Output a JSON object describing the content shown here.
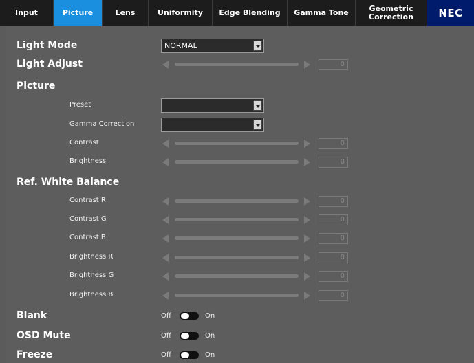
{
  "tabs": [
    {
      "label": "Input",
      "active": false
    },
    {
      "label": "Picture",
      "active": true
    },
    {
      "label": "Lens",
      "active": false
    },
    {
      "label": "Uniformity",
      "active": false
    },
    {
      "label": "Edge Blending",
      "active": false
    },
    {
      "label": "Gamma Tone",
      "active": false
    },
    {
      "label": "Geometric\nCorrection",
      "active": false
    }
  ],
  "logo": "NEC",
  "light_mode": {
    "label": "Light Mode",
    "value": "NORMAL"
  },
  "light_adjust": {
    "label": "Light Adjust",
    "value": "0"
  },
  "picture": {
    "label": "Picture",
    "preset": {
      "label": "Preset",
      "value": ""
    },
    "gamma_correction": {
      "label": "Gamma Correction",
      "value": ""
    },
    "contrast": {
      "label": "Contrast",
      "value": "0"
    },
    "brightness": {
      "label": "Brightness",
      "value": "0"
    }
  },
  "ref_white_balance": {
    "label": "Ref. White Balance",
    "contrast_r": {
      "label": "Contrast R",
      "value": "0"
    },
    "contrast_g": {
      "label": "Contrast G",
      "value": "0"
    },
    "contrast_b": {
      "label": "Contrast B",
      "value": "0"
    },
    "brightness_r": {
      "label": "Brightness R",
      "value": "0"
    },
    "brightness_g": {
      "label": "Brightness G",
      "value": "0"
    },
    "brightness_b": {
      "label": "Brightness B",
      "value": "0"
    }
  },
  "blank": {
    "label": "Blank",
    "off": "Off",
    "on": "On"
  },
  "osd_mute": {
    "label": "OSD Mute",
    "off": "Off",
    "on": "On"
  },
  "freeze": {
    "label": "Freeze",
    "off": "Off",
    "on": "On"
  },
  "colors": {
    "accent": "#1a8fe0",
    "logo_bg": "#001b6b",
    "panel": "#5d5d5d",
    "tab_bg": "#1c1c1c"
  }
}
